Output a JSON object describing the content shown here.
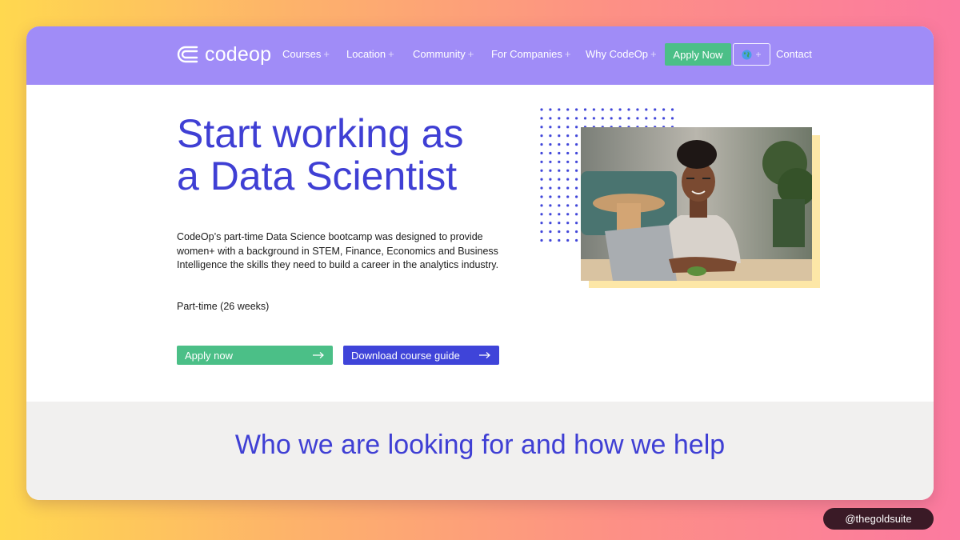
{
  "brand": {
    "name": "codeop"
  },
  "nav": {
    "items": [
      {
        "label": "Courses",
        "has_dropdown": true
      },
      {
        "label": "Location",
        "has_dropdown": true
      },
      {
        "label": "Community",
        "has_dropdown": true
      },
      {
        "label": "For Companies",
        "has_dropdown": true
      },
      {
        "label": "Why CodeOp",
        "has_dropdown": true
      }
    ],
    "plus": "+",
    "apply_label": "Apply Now",
    "language_icon": "globe-icon",
    "contact_label": "Contact"
  },
  "hero": {
    "title_line1": "Start working as",
    "title_line2": "a Data Scientist",
    "description": "CodeOp’s part-time Data Science bootcamp was designed to provide women+ with a background in STEM, Finance, Economics and Business Intelligence the skills they need to build a career in the analytics industry.",
    "duration": "Part-time (26 weeks)",
    "apply_label": "Apply now",
    "guide_label": "Download course guide"
  },
  "section2": {
    "title": "Who we are looking for and how we help"
  },
  "watermark": {
    "text": "@thegoldsuite"
  },
  "colors": {
    "nav_bg": "#a08cf7",
    "accent_blue": "#3f3fd4",
    "accent_green": "#4bbf87",
    "highlight_yellow": "#fde7a7"
  }
}
